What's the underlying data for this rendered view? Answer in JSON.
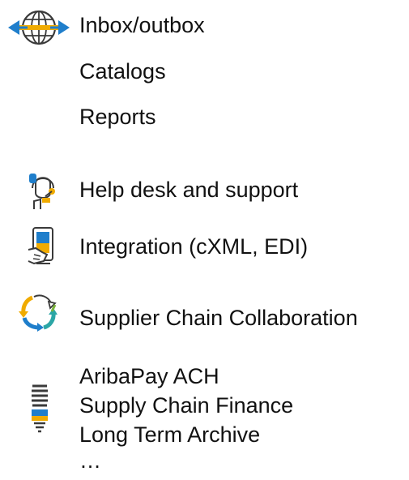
{
  "menu": {
    "inbox": {
      "label": "Inbox/outbox",
      "icon": "globe-arrows-icon"
    },
    "catalogs": {
      "label": "Catalogs"
    },
    "reports": {
      "label": "Reports"
    },
    "help_desk": {
      "label": "Help desk and support",
      "icon": "headset-agent-icon"
    },
    "integration": {
      "label": "Integration (cXML, EDI)",
      "icon": "mobile-hand-icon"
    },
    "collaboration": {
      "label": "Supplier Chain Collaboration",
      "icon": "recycle-arrows-icon"
    },
    "extras": {
      "icon": "lightbulb-icon",
      "items": [
        "AribaPay ACH",
        "Supply Chain Finance",
        "Long Term Archive",
        "…"
      ]
    }
  },
  "colors": {
    "orange": "#f0ab00",
    "blue": "#1f7ecb",
    "teal": "#2ba6a6",
    "green": "#7bb23a",
    "outline": "#3a3a3a"
  }
}
